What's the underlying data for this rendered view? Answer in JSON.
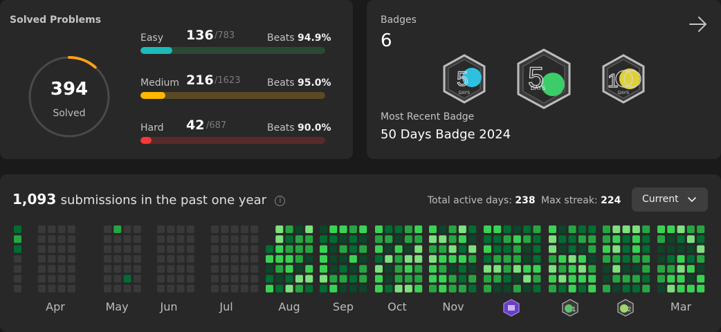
{
  "solved": {
    "title": "Solved Problems",
    "total": "394",
    "total_label": "Solved",
    "progress": 0.115,
    "ring_color": "#ffa116",
    "rows": [
      {
        "label": "Easy",
        "count": "136",
        "total": "/783",
        "beats_label": "Beats",
        "beats": "94.9%",
        "fraction": 0.174,
        "color": "#1cbaba",
        "track": "#2a4a34"
      },
      {
        "label": "Medium",
        "count": "216",
        "total": "/1623",
        "beats_label": "Beats",
        "beats": "95.0%",
        "fraction": 0.133,
        "color": "#ffb700",
        "track": "#5a4a24"
      },
      {
        "label": "Hard",
        "count": "42",
        "total": "/687",
        "beats_label": "Beats",
        "beats": "90.0%",
        "fraction": 0.061,
        "color": "#f63737",
        "track": "#5a2a2a"
      }
    ]
  },
  "badges": {
    "title": "Badges",
    "count": "6",
    "arrow_icon": "arrow-right-icon",
    "items": [
      {
        "name": "50-days-badge-icon",
        "digit": "50",
        "sub": "DAYS",
        "accent": "#2fc0e0"
      },
      {
        "name": "50-days-badge-2024-icon",
        "digit": "50",
        "sub": "DAYS",
        "accent": "#3dcc6a"
      },
      {
        "name": "100-days-badge-icon",
        "digit": "100",
        "sub": "DAYS",
        "accent": "#e0d038"
      }
    ],
    "recent_label": "Most Recent Badge",
    "recent_name": "50 Days Badge 2024"
  },
  "submissions": {
    "count": "1,093",
    "text": "submissions in the past one year",
    "info_icon": "i",
    "active_label": "Total active days:",
    "active_value": "238",
    "streak_label": "Max streak:",
    "streak_value": "224",
    "dropdown": "Current",
    "months": [
      "Apr",
      "May",
      "Jun",
      "Jul",
      "Aug",
      "Sep",
      "Oct",
      "Nov",
      "Mar"
    ],
    "colors": {
      "empty": "#393939",
      "l1": "#0e4429",
      "l2": "#006d32",
      "l3": "#26a641",
      "l4": "#39d353",
      "l5": "#7ee07e"
    }
  }
}
